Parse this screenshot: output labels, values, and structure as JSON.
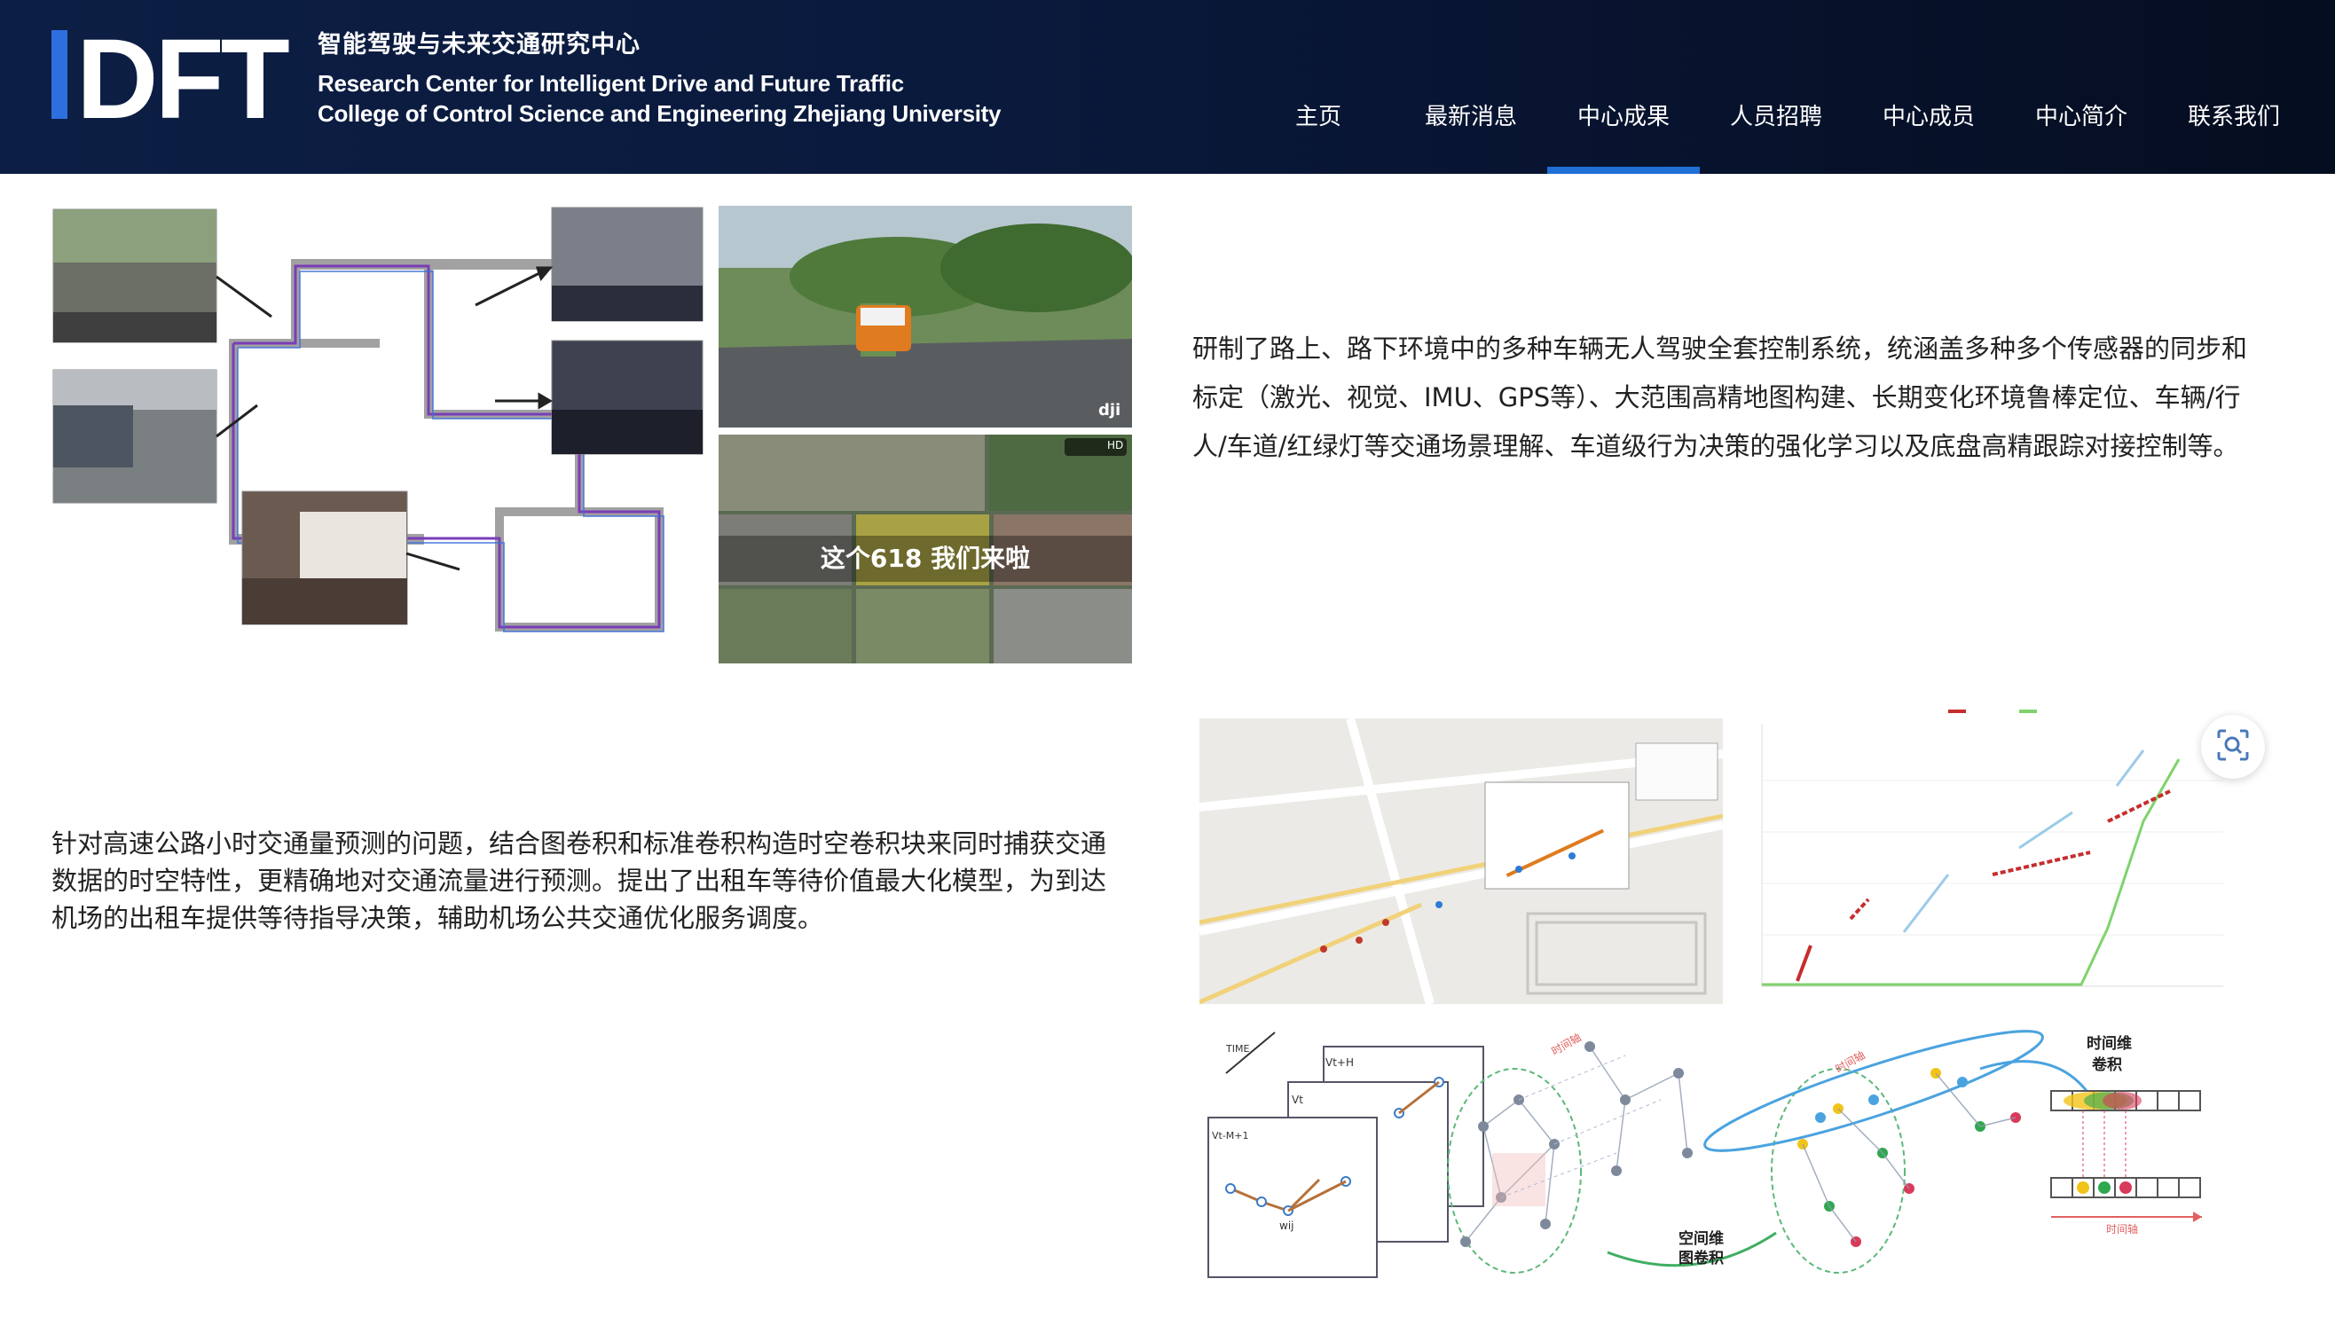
{
  "header": {
    "logo_text": "IDFT",
    "subtitle_cn": "智能驾驶与未来交通研究中心",
    "subtitle_en_1": "Research Center for Intelligent Drive and Future Traffic",
    "subtitle_en_2": "College of Control Science and Engineering Zhejiang University",
    "accent_color": "#1f6fd6",
    "logo_bar_color": "#2e6fe0"
  },
  "nav": {
    "items": [
      {
        "label": "主页"
      },
      {
        "label": "最新消息"
      },
      {
        "label": "中心成果",
        "active": true
      },
      {
        "label": "人员招聘"
      },
      {
        "label": "中心成员"
      },
      {
        "label": "中心简介"
      },
      {
        "label": "联系我们"
      }
    ]
  },
  "section1": {
    "text": "研制了路上、路下环境中的多种车辆无人驾驶全套控制系统，统涵盖多种多个传感器的同步和标定（激光、视觉、IMU、GPS等）、大范围高精地图构建、长期变化环境鲁棒定位、车辆/行人/车道/红绿灯等交通场景理解、车道级行为决策的强化学习以及底盘高精跟踪对接控制等。",
    "video_caption": "这个618 我们来啦",
    "video_badge": "HD"
  },
  "section2": {
    "text": "针对高速公路小时交通量预测的问题，结合图卷积和标准卷积构造时空卷积块来同时捕获交通数据的时空特性，更精确地对交通流量进行预测。提出了出租车等待价值最大化模型，为到达机场的出租车提供等待指导决策，辅助机场公共交通优化服务调度。",
    "diagram": {
      "time_label": "TIME",
      "v_top": "Vt+H",
      "v_mid": "Vt",
      "v_front": "Vt-M+1",
      "w_label": "wij",
      "time_axis_1": "时间轴",
      "time_axis_2": "时间轴",
      "time_axis_3": "时间轴",
      "time_conv_1": "时间维",
      "time_conv_2": "卷积",
      "space_conv_1": "空间维",
      "space_conv_2": "图卷积"
    }
  },
  "scan_button_icon": "scan-search-icon"
}
